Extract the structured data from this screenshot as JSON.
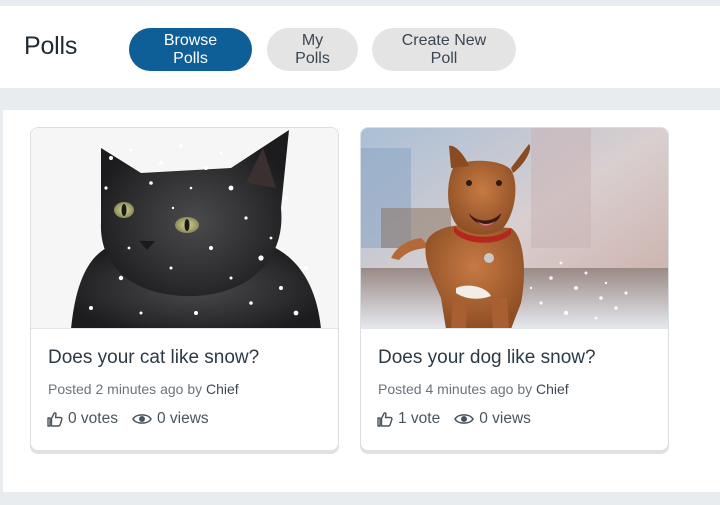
{
  "header": {
    "title": "Polls",
    "nav": [
      {
        "label": "Browse Polls",
        "active": true
      },
      {
        "label": "My Polls",
        "active": false
      },
      {
        "label": "Create New Poll",
        "active": false
      }
    ]
  },
  "polls": [
    {
      "image": "kitten-in-snow",
      "title": "Does your cat like snow?",
      "posted_prefix": "Posted",
      "time": "2 minutes ago",
      "by": "by",
      "author": "Chief",
      "votes": "0 votes",
      "views": "0 views"
    },
    {
      "image": "dog-in-snow",
      "title": "Does your dog like snow?",
      "posted_prefix": "Posted",
      "time": "4 minutes ago",
      "by": "by",
      "author": "Chief",
      "votes": "1 vote",
      "views": "0 views"
    }
  ],
  "colors": {
    "primary": "#0e5f97",
    "inactive_button": "#e4e4e4",
    "page_background": "#e9ecef"
  }
}
